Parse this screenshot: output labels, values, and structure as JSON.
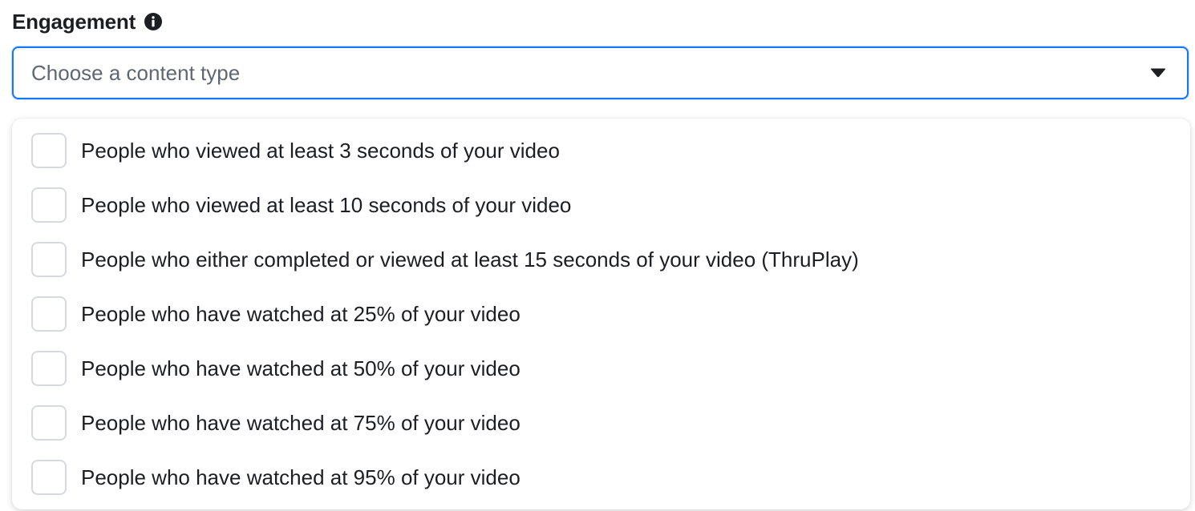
{
  "field": {
    "label": "Engagement",
    "info_icon": "info-circle-icon",
    "placeholder": "Choose a content type",
    "caret_icon": "caret-down-icon",
    "focus_color": "#1877f2"
  },
  "options": [
    {
      "label": "People who viewed at least 3 seconds of your video",
      "checked": false
    },
    {
      "label": "People who viewed at least 10 seconds of your video",
      "checked": false
    },
    {
      "label": "People who either completed or viewed at least 15 seconds of your video (ThruPlay)",
      "checked": false
    },
    {
      "label": "People who have watched at 25% of your video",
      "checked": false
    },
    {
      "label": "People who have watched at 50% of your video",
      "checked": false
    },
    {
      "label": "People who have watched at 75% of your video",
      "checked": false
    },
    {
      "label": "People who have watched at 95% of your video",
      "checked": false
    }
  ]
}
